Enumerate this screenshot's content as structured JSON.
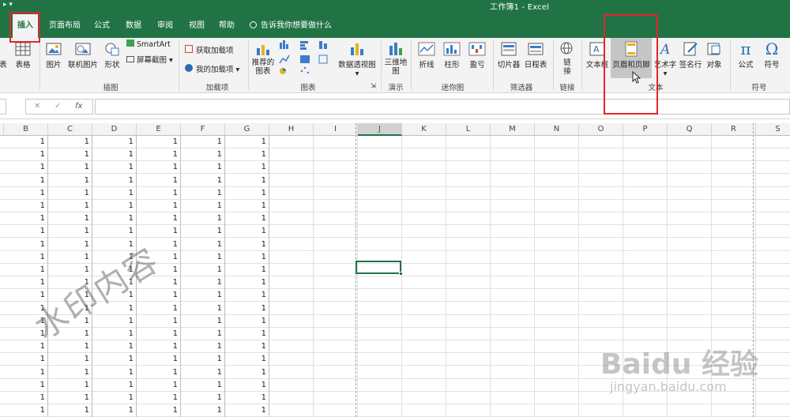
{
  "window": {
    "quick_access": "▸  ▾",
    "title": "工作簿1  -  Excel"
  },
  "tabs": [
    {
      "label": "插入",
      "active": true
    },
    {
      "label": "页面布局"
    },
    {
      "label": "公式"
    },
    {
      "label": "数据"
    },
    {
      "label": "审阅"
    },
    {
      "label": "视图"
    },
    {
      "label": "帮助"
    }
  ],
  "tell_me": "告诉我你想要做什么",
  "ribbon": {
    "tables": {
      "table_clipped": "表",
      "table": "表格"
    },
    "illustrations": {
      "picture": "图片",
      "online_picture": "联机图片",
      "shapes": "形状",
      "smartart": "SmartArt",
      "screenshot": "屏幕截图",
      "label": "插图"
    },
    "addins": {
      "get_addins": "获取加载项",
      "my_addins": "我的加载项",
      "label": "加载项"
    },
    "charts": {
      "recommended": "推荐的\n图表",
      "pivot_chart": "数据透视图",
      "label": "图表"
    },
    "tours": {
      "map3d": "三维地\n图",
      "label": "演示"
    },
    "sparklines": {
      "line": "折线",
      "column": "柱形",
      "winloss": "盈亏",
      "label": "迷你图"
    },
    "filters": {
      "slicer": "切片器",
      "timeline": "日程表",
      "label": "筛选器"
    },
    "links": {
      "link": "链\n接",
      "label": "链接"
    },
    "text": {
      "textbox": "文本框",
      "header_footer": "页眉和页脚",
      "wordart": "艺术字",
      "signature": "签名行",
      "object": "对象",
      "label": "文本"
    },
    "symbols": {
      "equation": "公式",
      "symbol": "符号",
      "label": "符号"
    }
  },
  "formula_bar": {
    "cancel": "✕",
    "enter": "✓",
    "fx": "fx",
    "value": ""
  },
  "columns": [
    "B",
    "C",
    "D",
    "E",
    "F",
    "G",
    "H",
    "I",
    "J",
    "K",
    "L",
    "M",
    "N",
    "O",
    "P",
    "Q",
    "R",
    "S"
  ],
  "selected_column": "J",
  "cell_value": "1",
  "filled_rows": 22,
  "watermark_text": "水印内容",
  "baidu_watermark": {
    "brand": "Baidu 经验",
    "url": "jingyan.baidu.com"
  },
  "colors": {
    "excel_green": "#217346",
    "annotation_red": "#e0262a"
  }
}
